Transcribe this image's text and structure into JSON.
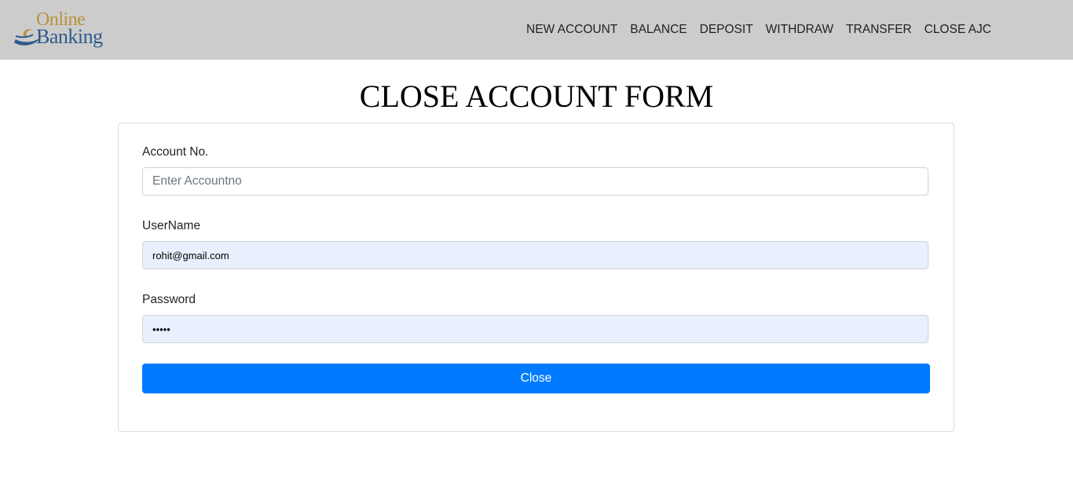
{
  "logo": {
    "line1": "Online",
    "line2": "Banking",
    "icon": "swoosh-logo-icon"
  },
  "nav": {
    "items": [
      {
        "label": "NEW ACCOUNT"
      },
      {
        "label": "BALANCE"
      },
      {
        "label": "DEPOSIT"
      },
      {
        "label": "WITHDRAW"
      },
      {
        "label": "TRANSFER"
      },
      {
        "label": "CLOSE AJC"
      }
    ]
  },
  "page": {
    "title": "CLOSE ACCOUNT FORM"
  },
  "form": {
    "account": {
      "label": "Account No.",
      "placeholder": "Enter Accountno",
      "value": ""
    },
    "username": {
      "label": "UserName",
      "value": "rohit@gmail.com"
    },
    "password": {
      "label": "Password",
      "value": "•••••"
    },
    "submit_label": "Close"
  },
  "colors": {
    "navbar_bg": "#cccccc",
    "primary": "#007bff",
    "autofill_bg": "#e8f0fe",
    "logo_gold": "#b8923a",
    "logo_blue": "#2e5a8c"
  }
}
